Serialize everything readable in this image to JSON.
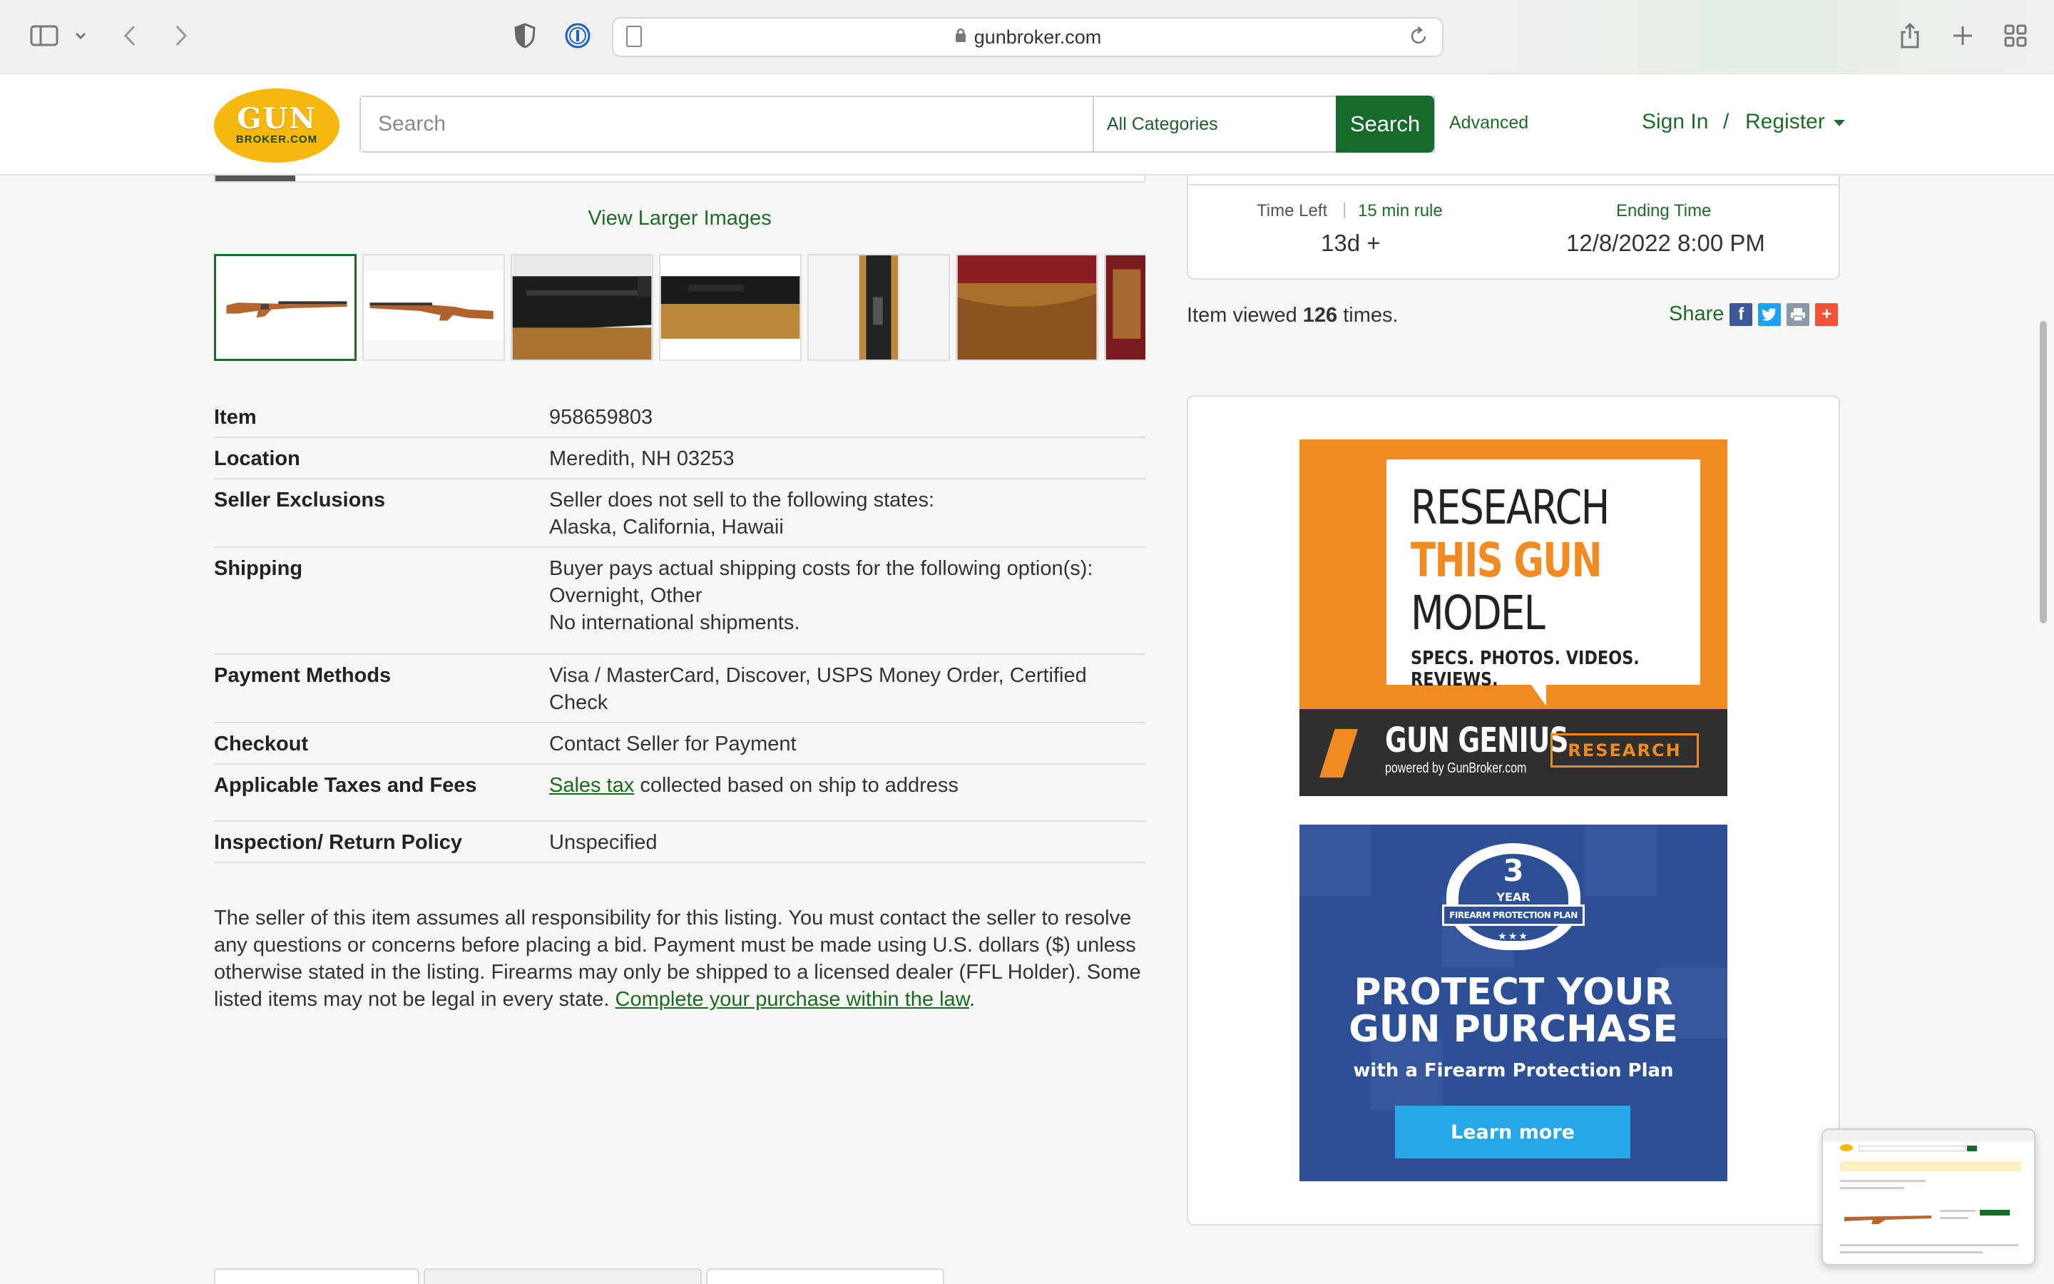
{
  "browser": {
    "url": "gunbroker.com"
  },
  "header": {
    "logo_top": "GUN",
    "logo_bottom": "BROKER.COM",
    "search_placeholder": "Search",
    "category": "All Categories",
    "search_button": "Search",
    "advanced": "Advanced",
    "sign_in": "Sign In",
    "separator": "/",
    "register": "Register"
  },
  "gallery": {
    "view_larger": "View Larger Images",
    "thumbnail_count": 7
  },
  "details": [
    {
      "label": "Item",
      "value": "958659803"
    },
    {
      "label": "Location",
      "value": "Meredith, NH 03253"
    },
    {
      "label": "Seller Exclusions",
      "value_lines": [
        "Seller does not sell to the following states:",
        "Alaska, California, Hawaii"
      ]
    },
    {
      "label": "Shipping",
      "value_lines": [
        "Buyer pays actual shipping costs for the following option(s):",
        "Overnight, Other",
        "No international shipments."
      ]
    },
    {
      "label": "Payment Methods",
      "value": "Visa / MasterCard, Discover, USPS Money Order, Certified Check"
    },
    {
      "label": "Checkout",
      "value": "Contact Seller for Payment"
    },
    {
      "label": "Applicable Taxes and Fees",
      "link": "Sales tax",
      "value": " collected based on ship to address"
    },
    {
      "label": "Inspection/ Return Policy",
      "value": "Unspecified"
    }
  ],
  "disclaimer": {
    "text": "The seller of this item assumes all responsibility for this listing. You must contact the seller to resolve any questions or concerns before placing a bid. Payment must be made using U.S. dollars ($) unless otherwise stated in the listing. Firearms may only be shipped to a licensed dealer (FFL Holder). Some listed items may not be legal in every state. ",
    "link": "Complete your purchase within the law",
    "end": "."
  },
  "time": {
    "time_left_label": "Time Left",
    "sep": "|",
    "rule_link": "15 min rule",
    "time_left_value": "13d +",
    "ending_label": "Ending Time",
    "ending_value": "12/8/2022 8:00 PM"
  },
  "views": {
    "prefix": "Item viewed ",
    "count": "126",
    "suffix": " times."
  },
  "share": {
    "label": "Share",
    "icons": [
      "facebook-icon",
      "twitter-icon",
      "print-icon",
      "plus-icon"
    ],
    "colors": {
      "facebook": "#3b5998",
      "twitter": "#1da1f2",
      "print": "#8a9aa8",
      "plus": "#f0533a"
    }
  },
  "ads": {
    "research": {
      "line1": "RESEARCH",
      "line2": "THIS GUN",
      "line3": "MODEL",
      "tagline": "SPECS. PHOTOS. VIDEOS. REVIEWS.",
      "brand": "GUN GENIUS",
      "brand_sub": "powered by GunBroker.com",
      "button": "RESEARCH",
      "color": "#f08a23"
    },
    "protect": {
      "badge_number": "3",
      "badge_year": "YEAR",
      "badge_text": "FIREARM PROTECTION PLAN",
      "badge_stars": "★★★",
      "headline1": "PROTECT YOUR",
      "headline2": "GUN PURCHASE",
      "subline": "with a Firearm Protection Plan",
      "button": "Learn more",
      "color": "#2c4f96"
    }
  },
  "colors": {
    "brand_green": "#156b2b",
    "link_green": "#1e6b2b",
    "logo_yellow": "#f5b80e"
  }
}
